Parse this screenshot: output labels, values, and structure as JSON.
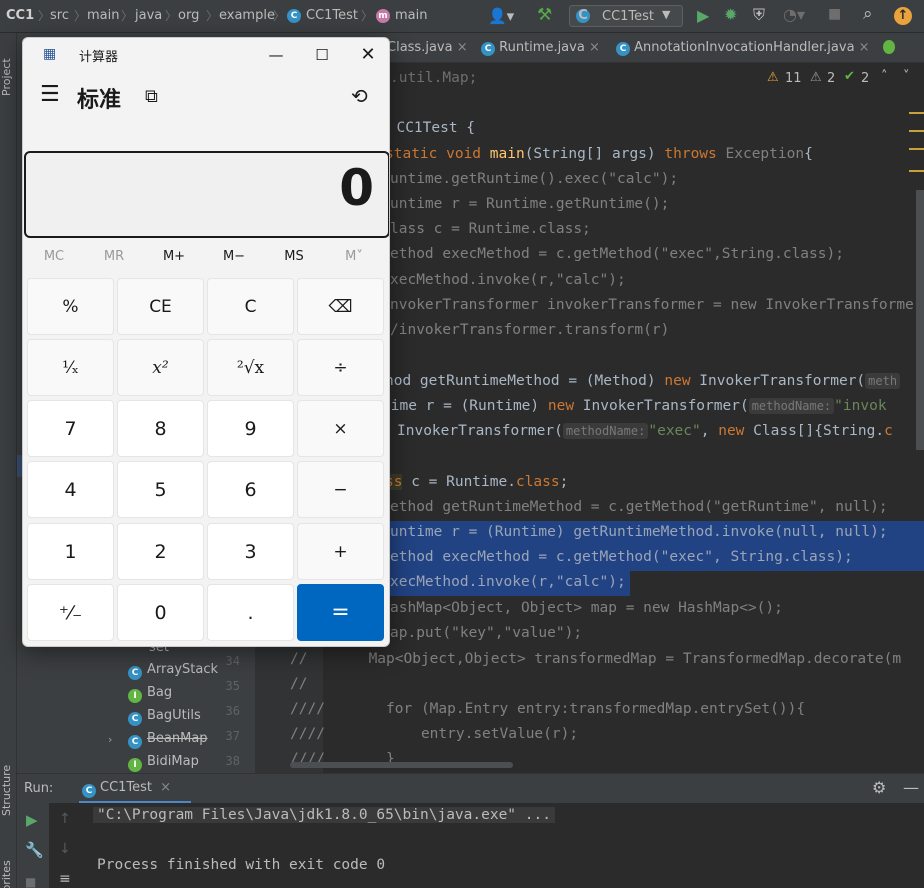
{
  "navbar": {
    "breadcrumbs": [
      "CC1",
      "src",
      "main",
      "java",
      "org",
      "example",
      "CC1Test",
      "main"
    ],
    "run_config": "CC1Test"
  },
  "sidebar": {
    "project_tab": "Project",
    "structure_tab": "Structure",
    "favorites_tab": "Favorites"
  },
  "project_tree": {
    "items": [
      {
        "label": "set",
        "kind": "folder"
      },
      {
        "label": "ArrayStack",
        "kind": "class"
      },
      {
        "label": "Bag",
        "kind": "interface"
      },
      {
        "label": "BagUtils",
        "kind": "class"
      },
      {
        "label": "BeanMap",
        "kind": "class"
      },
      {
        "label": "BidiMap",
        "kind": "interface"
      }
    ]
  },
  "editor": {
    "tabs": [
      "Class.java",
      "Runtime.java",
      "AnnotationInvocationHandler.java"
    ],
    "inspections": {
      "warnings": "11",
      "weak_warnings": "2",
      "typos": "2"
    },
    "line_numbers": [
      "34",
      "35",
      "36",
      "37",
      "38"
    ],
    "hints": {
      "method_name": "methodName:"
    }
  },
  "calculator": {
    "title": "计算器",
    "mode": "标准",
    "display": "0",
    "memory": [
      "MC",
      "MR",
      "M+",
      "M−",
      "MS",
      "M˅"
    ],
    "keys": [
      [
        "%",
        "CE",
        "C",
        "⌫"
      ],
      [
        "¹⁄ₓ",
        "x²",
        "²√x",
        "÷"
      ],
      [
        "7",
        "8",
        "9",
        "×"
      ],
      [
        "4",
        "5",
        "6",
        "−"
      ],
      [
        "1",
        "2",
        "3",
        "+"
      ],
      [
        "⁺⁄₋",
        "0",
        ".",
        "="
      ]
    ]
  },
  "run_panel": {
    "label": "Run:",
    "tab": "CC1Test",
    "command": "\"C:\\Program Files\\Java\\jdk1.8.0_65\\bin\\java.exe\" ...",
    "result": "Process finished with exit code 0"
  }
}
